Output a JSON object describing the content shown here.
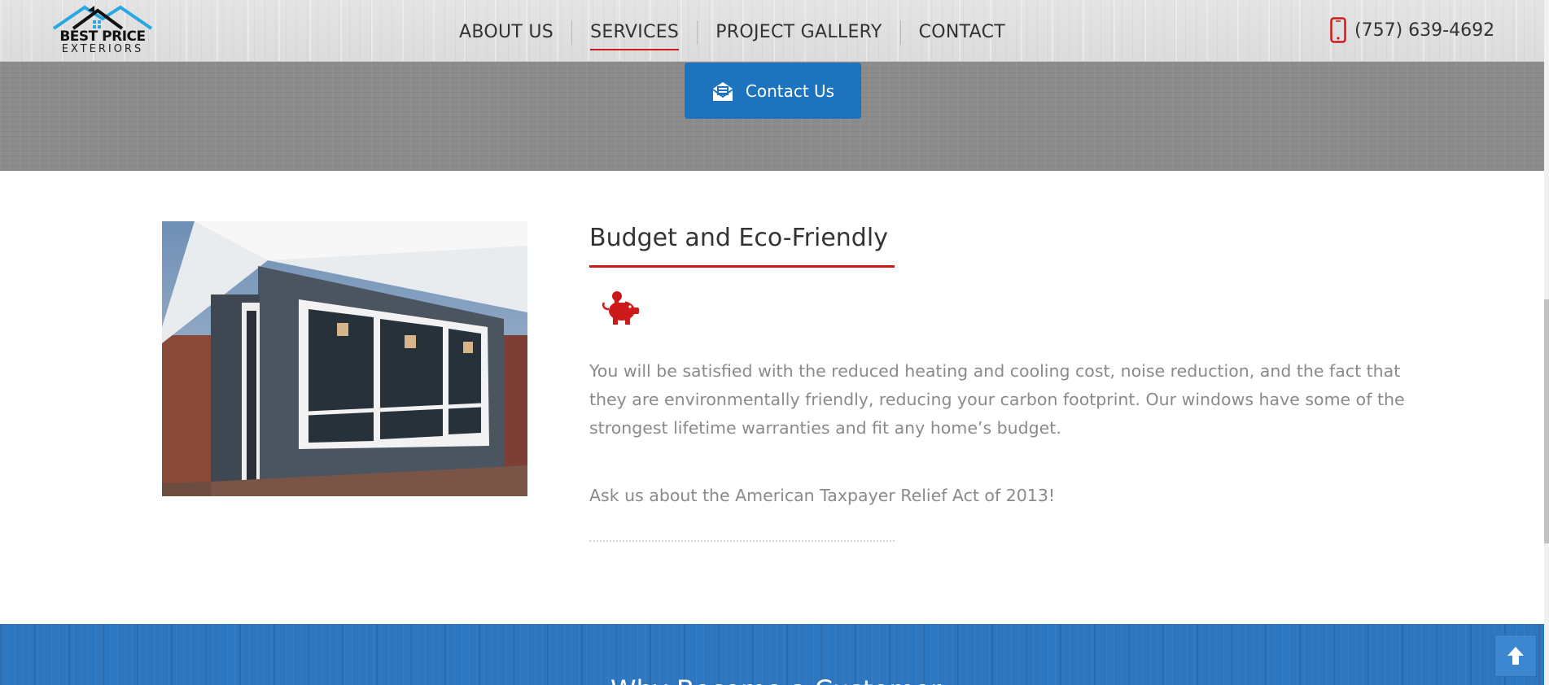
{
  "header": {
    "logo": {
      "line1": "BEST PRICE",
      "line2": "EXTERIORS"
    },
    "nav": [
      {
        "label": "ABOUT US",
        "active": false
      },
      {
        "label": "SERVICES",
        "active": true
      },
      {
        "label": "PROJECT GALLERY",
        "active": false
      },
      {
        "label": "CONTACT",
        "active": false
      }
    ],
    "phone": {
      "icon": "mobile-phone-icon",
      "text": "(757) 639-4692"
    }
  },
  "cta": {
    "icon": "envelope-open-icon",
    "label": "Contact Us",
    "color": "#1e73be"
  },
  "feature": {
    "image": "house-windows-photo",
    "title": "Budget and Eco-Friendly",
    "icon": "piggy-bank-icon",
    "accent": "#cc1a1a",
    "paragraph": "You will be satisfied with the reduced heating and cooling cost, noise reduction, and the fact that they are environmentally friendly, reducing your carbon footprint. Our windows have some of the strongest lifetime warranties and fit any home’s budget.",
    "note": "Ask us about the American Taxpayer Relief Act of 2013!"
  },
  "footer": {
    "heading": "Why Become a Customer",
    "background": "#2d76c0"
  },
  "back_to_top": {
    "icon": "arrow-up-icon"
  }
}
